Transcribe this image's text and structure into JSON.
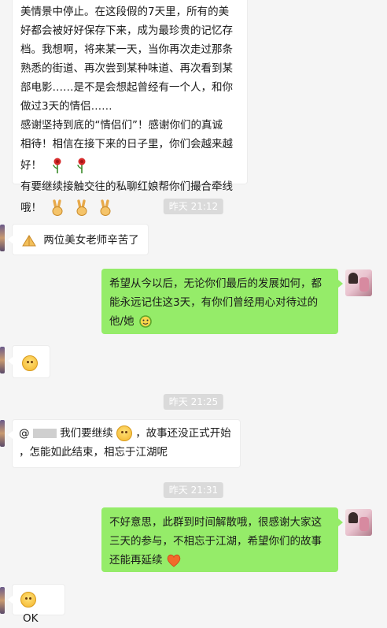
{
  "messages": {
    "m1": {
      "lines": [
        "美情景中停止。在这段假的7天里，所有的美",
        "好都会被好好保存下来，成为最珍贵的记忆存",
        "档。我想啊，将来某一天，当你再次走过那条",
        "熟悉的街道、再次尝到某种味道、再次看到某",
        "部电影……是不是会想起曾经有一个人，和你",
        "做过3天的情侣……",
        "感谢坚持到底的“情侣们”！感谢你们的真诚",
        "相待！相信在接下来的日子里，你们会越来越",
        "好！",
        "有要继续接触交往的私聊红娘帮你们撮合牵线",
        "哦！"
      ]
    },
    "ts1": "昨天 21:12",
    "m2": {
      "text": "两位美女老师辛苦了"
    },
    "m3": {
      "lines": [
        "希望从今以后，无论你们最后的发展如何，都",
        "能永远记住这3天，有你们曾经用心对待过的",
        "他/她"
      ]
    },
    "ts2": "昨天 21:25",
    "m5": {
      "mention": "@",
      "text1": " 我们要继续",
      "text2": "，故事还没正式开始",
      "line2": "，怎能如此结束，相忘于江湖呢"
    },
    "ts3": "昨天 21:31",
    "m6": {
      "lines": [
        "不好意思，此群到时间解散哦，很感谢大家这",
        "三天的参与，不相忘于江湖，希望你们的故事",
        "还能再延续"
      ]
    },
    "m7": {
      "text": "OK"
    },
    "icons": {
      "rose": "rose-icon",
      "victory": "victory-hand-icon",
      "pray": "pray-hands-icon",
      "smile": "smile-icon",
      "heart": "heart-icon"
    },
    "colors": {
      "right_bubble": "#95ec69",
      "left_bubble": "#ffffff",
      "background": "#f5f5f5",
      "timestamp": "#dadada"
    }
  }
}
